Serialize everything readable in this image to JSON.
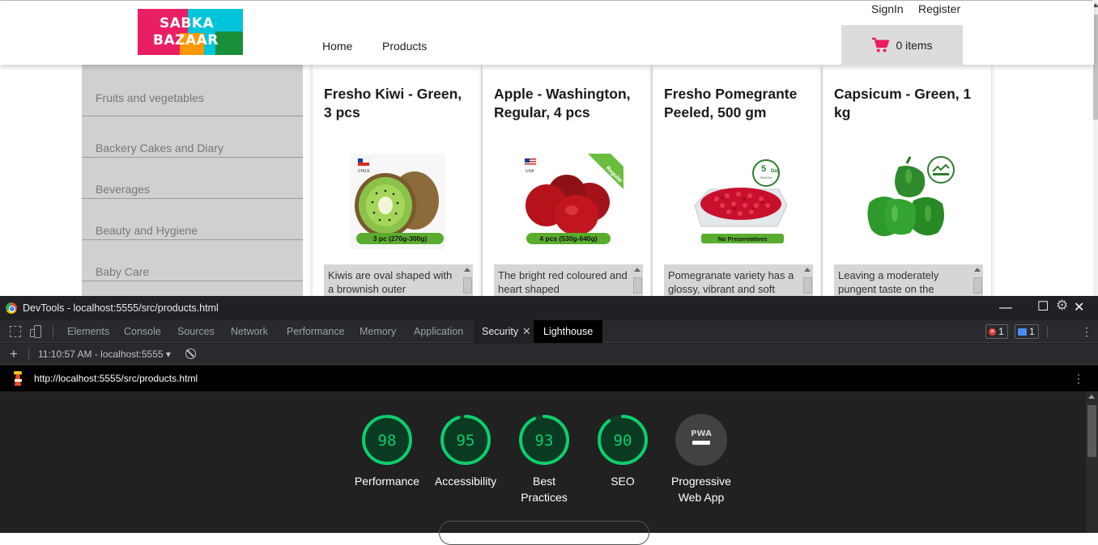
{
  "shop": {
    "logo": {
      "line1": "SABKA",
      "line2": "BAZAAR"
    },
    "nav": {
      "home": "Home",
      "products": "Products"
    },
    "auth": {
      "signin": "SignIn",
      "register": "Register"
    },
    "cart": {
      "label": "0 items",
      "accent": "#e91e63"
    },
    "categories": [
      "Fruits and vegetables",
      "Backery Cakes and Diary",
      "Beverages",
      "Beauty and Hygiene",
      "Baby Care"
    ],
    "products": [
      {
        "title": "Fresho Kiwi - Green, 3 pcs",
        "flag_label": "CHILE",
        "pack_label": "3 pc (270g-300g)",
        "description": "Kiwis are oval shaped with a brownish outer"
      },
      {
        "title": "Apple - Washington, Regular, 4 pcs",
        "flag_label": "USA",
        "ribbon": "Regular",
        "pack_label": "4 pcs (530g-640g)",
        "description": "The bright red coloured and heart shaped"
      },
      {
        "title": "Fresho Pomegrante Peeled, 500 gm",
        "badge_line1": "5",
        "badge_line2": "Day",
        "badge_line3": "Shelf life",
        "pack_label": "No Preservatives",
        "description": "Pomegranate variety has a glossy, vibrant and soft"
      },
      {
        "title": "Capsicum - Green, 1 kg",
        "description": "Leaving a moderately pungent taste on the"
      }
    ]
  },
  "devtools": {
    "window_title": "DevTools - localhost:5555/src/products.html",
    "tabs": [
      "Elements",
      "Console",
      "Sources",
      "Network",
      "Performance",
      "Memory",
      "Application",
      "Security",
      "Lighthouse"
    ],
    "active_tab": "Lighthouse",
    "error_count": "1",
    "message_count": "1",
    "run_label": "11:10:57 AM - localhost:5555",
    "report_url": "http://localhost:5555/src/products.html",
    "scores": [
      {
        "label_line1": "Performance",
        "label_line2": "",
        "score": "98"
      },
      {
        "label_line1": "Accessibility",
        "label_line2": "",
        "score": "95"
      },
      {
        "label_line1": "Best",
        "label_line2": "Practices",
        "score": "93"
      },
      {
        "label_line1": "SEO",
        "label_line2": "",
        "score": "90"
      },
      {
        "label_line1": "Progressive",
        "label_line2": "Web App",
        "score": "PWA"
      }
    ],
    "colors": {
      "pass": "#0cce6b",
      "pass_bg": "#0b3a22",
      "pwa_bg": "#424242"
    }
  }
}
